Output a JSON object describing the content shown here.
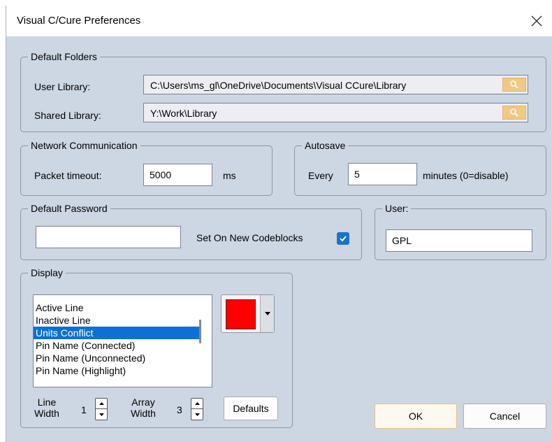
{
  "window": {
    "title": "Visual C/Cure Preferences",
    "close_glyph": "×"
  },
  "default_folders": {
    "label": "Default Folders",
    "user_library_label": "User Library:",
    "user_library_value": "C:\\Users\\ms_gl\\OneDrive\\Documents\\Visual CCure\\Library",
    "shared_library_label": "Shared Library:",
    "shared_library_value": "Y:\\Work\\Library",
    "browse_icon": "magnifier-icon"
  },
  "network": {
    "label": "Network Communication",
    "packet_timeout_label": "Packet timeout:",
    "packet_timeout_value": "5000",
    "unit": "ms"
  },
  "autosave": {
    "label": "Autosave",
    "every_label": "Every",
    "value": "5",
    "unit_label": "minutes (0=disable)"
  },
  "password": {
    "label": "Default Password",
    "value": "",
    "checkbox_label": "Set On New Codeblocks",
    "checked": true
  },
  "user": {
    "label": "User:",
    "value": "GPL"
  },
  "display": {
    "label": "Display",
    "list_items": [
      "Active Line",
      "Inactive Line",
      "Units Conflict",
      "Pin Name (Connected)",
      "Pin Name (Unconnected)",
      "Pin Name (Highlight)"
    ],
    "selected_index": 2,
    "color": "#ff0000",
    "line_width_label_1": "Line",
    "line_width_label_2": "Width",
    "line_width_value": "1",
    "array_width_label_1": "Array",
    "array_width_label_2": "Width",
    "array_width_value": "3",
    "defaults_button": "Defaults"
  },
  "buttons": {
    "ok": "OK",
    "cancel": "Cancel"
  },
  "colors": {
    "accent": "#0d70d5",
    "dialog_bg": "#cdd6e3",
    "browse_bg": "#f0c987"
  }
}
